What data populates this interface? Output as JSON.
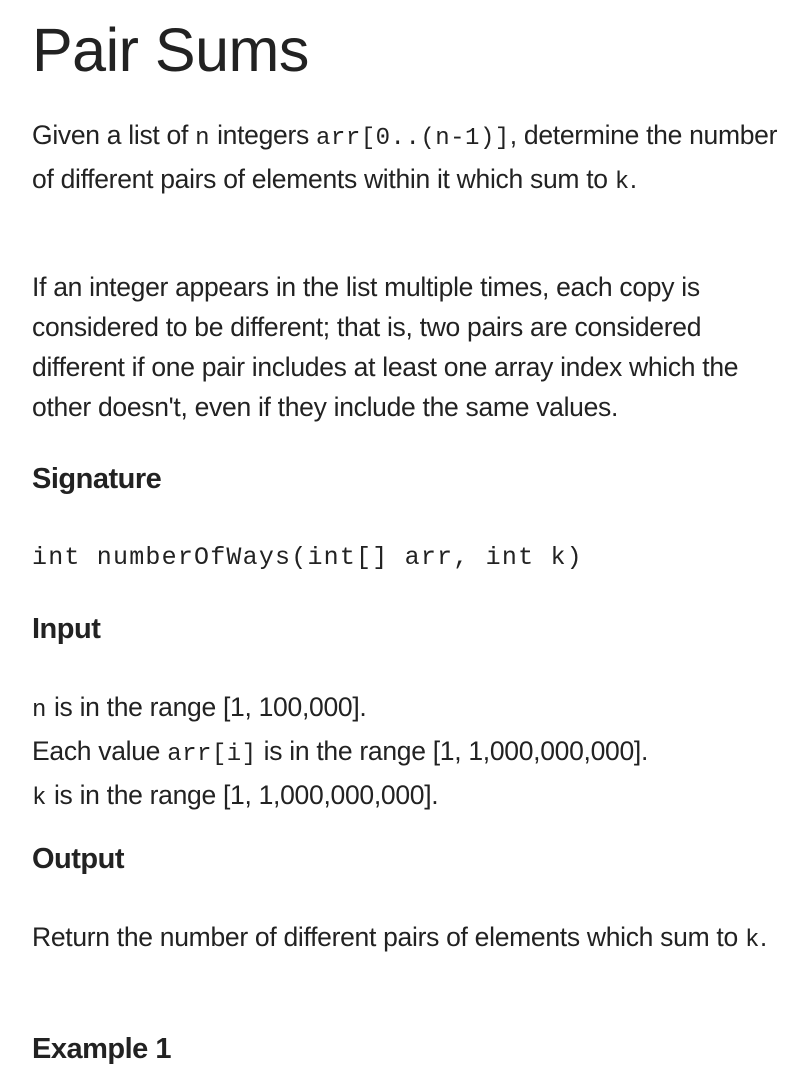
{
  "title": "Pair Sums",
  "intro": {
    "t1": "Given a list of ",
    "c1": "n",
    "t2": " integers ",
    "c2": "arr[0..(n-1)]",
    "t3": ", determine the number of different pairs of elements within it which sum to ",
    "c3": "k",
    "t4": "."
  },
  "explanation": "If an integer appears in the list multiple times, each copy is considered to be different; that is, two pairs are considered different if one pair includes at least one array index which the other doesn't, even if they include the same values.",
  "signature": {
    "heading": "Signature",
    "code": "int numberOfWays(int[] arr, int k)"
  },
  "input": {
    "heading": "Input",
    "line1": {
      "code": "n",
      "text": " is in the range [1, 100,000]."
    },
    "line2": {
      "pre": "Each value ",
      "code": "arr[i]",
      "text": " is in the range [1, 1,000,000,000]."
    },
    "line3": {
      "code": "k",
      "text": " is in the range [1, 1,000,000,000]."
    }
  },
  "output": {
    "heading": "Output",
    "t1": "Return the number of different pairs of elements which sum to ",
    "code": "k",
    "t2": "."
  },
  "example1": {
    "heading": "Example 1"
  }
}
